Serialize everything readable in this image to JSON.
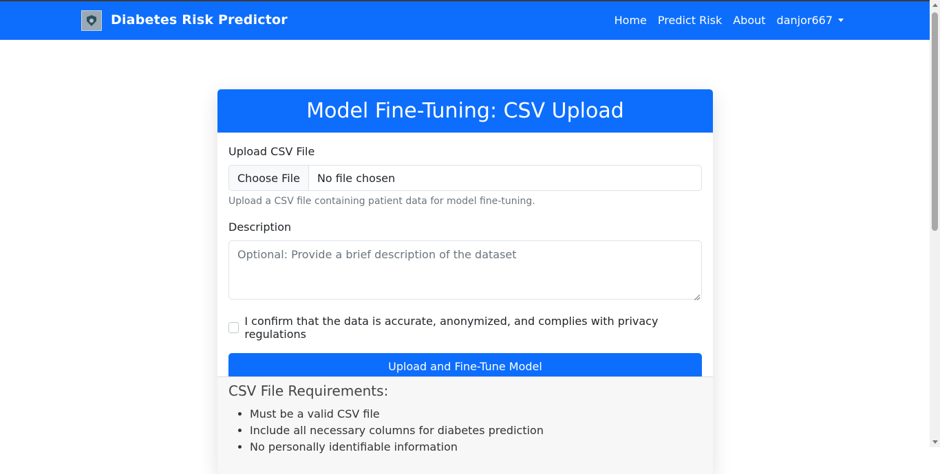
{
  "navbar": {
    "brand": "Diabetes Risk Predictor",
    "logo_icon": "shield-logo-icon",
    "links": [
      "Home",
      "Predict Risk",
      "About"
    ],
    "user": "danjor667",
    "color": "#0d6efd"
  },
  "card": {
    "title": "Model Fine-Tuning: CSV Upload",
    "upload_label": "Upload CSV File",
    "file_button": "Choose File",
    "file_status": "No file chosen",
    "help_text": "Upload a CSV file containing patient data for model fine-tuning.",
    "description_label": "Description",
    "description_placeholder": "Optional: Provide a brief description of the dataset",
    "confirm_label": "I confirm that the data is accurate, anonymized, and complies with privacy regulations",
    "submit_label": "Upload and Fine-Tune Model"
  },
  "requirements": {
    "title": "CSV File Requirements:",
    "items": [
      "Must be a valid CSV file",
      "Include all necessary columns for diabetes prediction",
      "No personally identifiable information"
    ]
  }
}
